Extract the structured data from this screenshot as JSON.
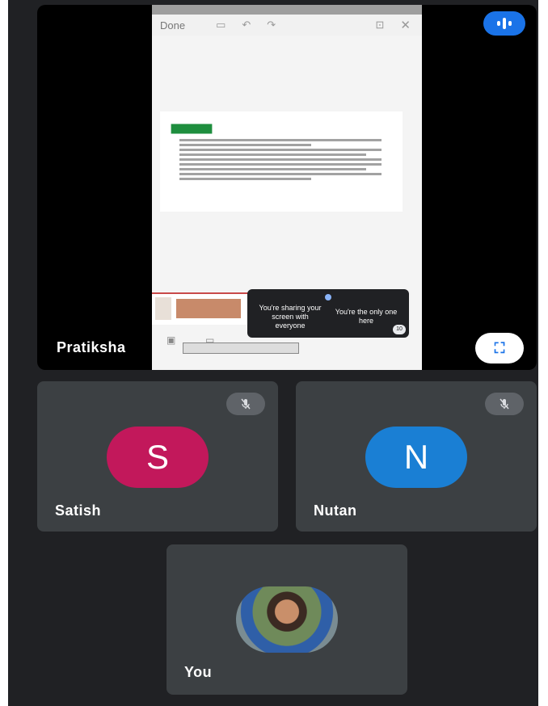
{
  "shared_screen": {
    "toolbar": {
      "done_label": "Done"
    },
    "toast": {
      "sharing_text": "You're sharing your screen with everyone",
      "only_one_text": "You're the only one here",
      "count": "10"
    }
  },
  "presenter": {
    "name": "Pratiksha"
  },
  "participants": [
    {
      "name": "Satish",
      "initial": "S"
    },
    {
      "name": "Nutan",
      "initial": "N"
    }
  ],
  "self": {
    "name": "You"
  },
  "colors": {
    "background": "#202124",
    "tile": "#3c4043",
    "satish_avatar": "#c2185b",
    "nutan_avatar": "#1a7fd4",
    "accent": "#1a73e8"
  }
}
